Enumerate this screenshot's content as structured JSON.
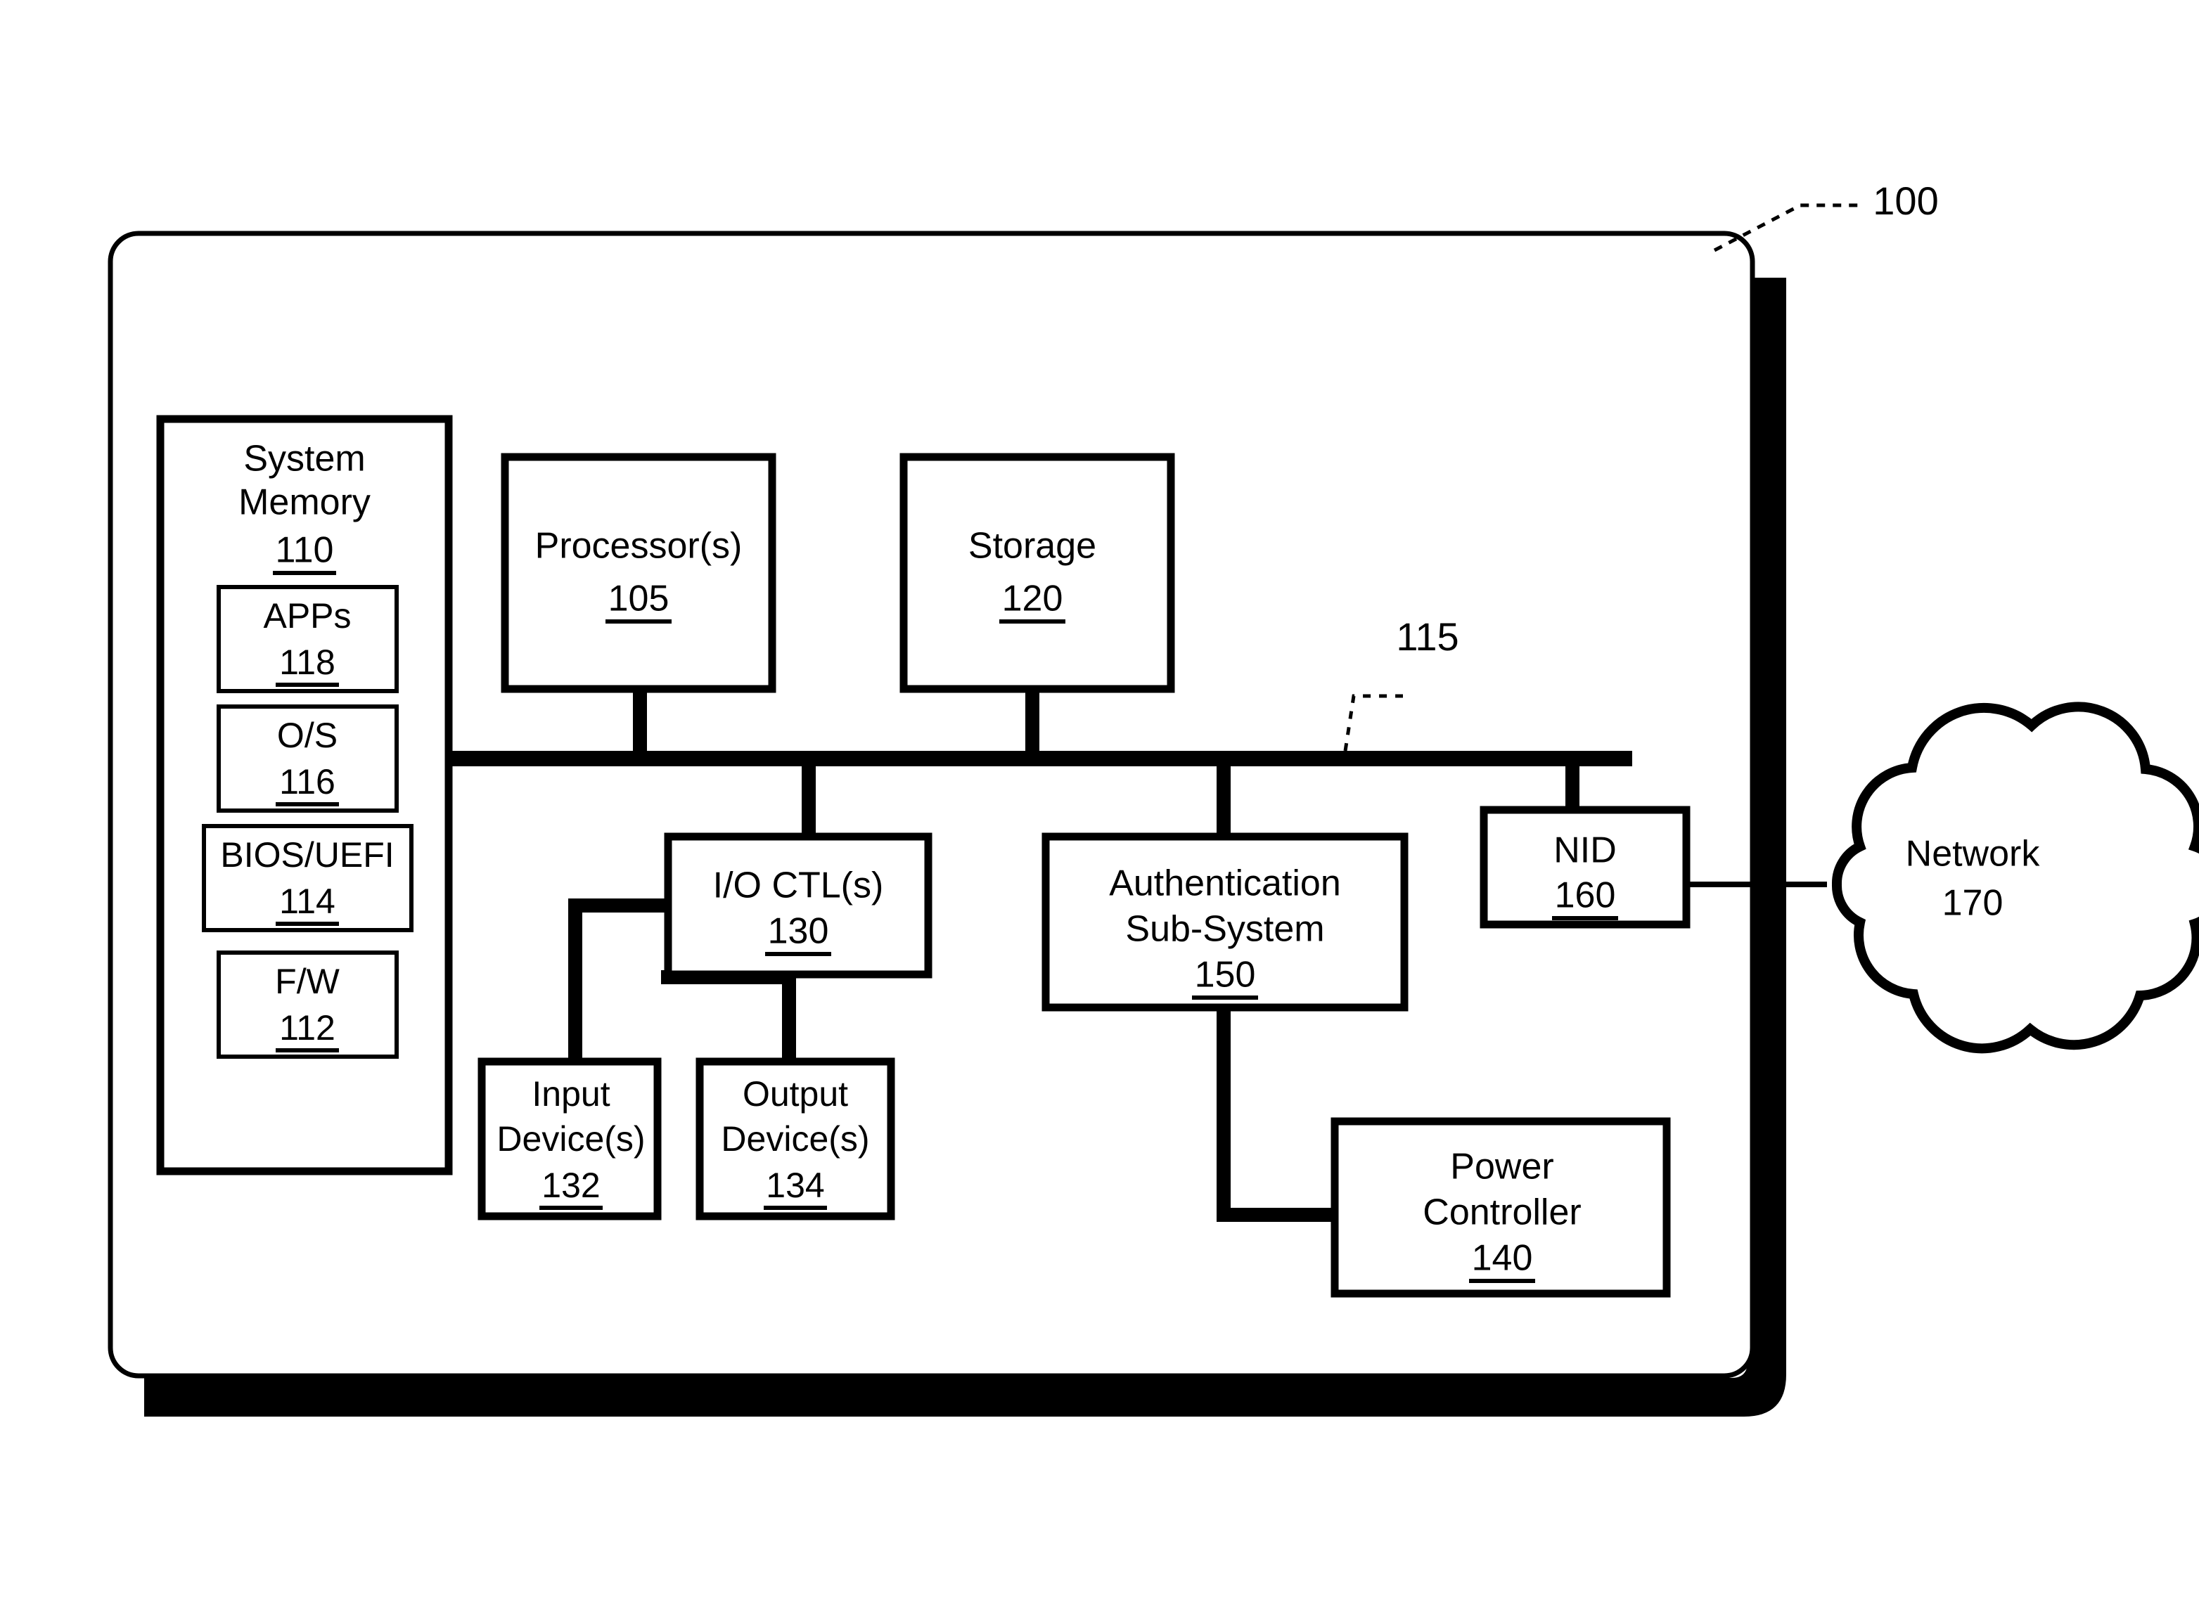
{
  "figure": {
    "type": "patent-block-diagram",
    "device_reference": "100",
    "bus_reference": "115"
  },
  "leaders": {
    "device": "100",
    "bus": "115"
  },
  "blocks": {
    "system_memory": {
      "title_line1": "System",
      "title_line2": "Memory",
      "ref": "110",
      "children": [
        {
          "label": "APPs",
          "ref": "118"
        },
        {
          "label": "O/S",
          "ref": "116"
        },
        {
          "label": "BIOS/UEFI",
          "ref": "114"
        },
        {
          "label": "F/W",
          "ref": "112"
        }
      ]
    },
    "processor": {
      "label": "Processor(s)",
      "ref": "105"
    },
    "storage": {
      "label": "Storage",
      "ref": "120"
    },
    "io_ctl": {
      "label": "I/O CTL(s)",
      "ref": "130"
    },
    "input_device": {
      "line1": "Input",
      "line2": "Device(s)",
      "ref": "132"
    },
    "output_device": {
      "line1": "Output",
      "line2": "Device(s)",
      "ref": "134"
    },
    "auth_subsystem": {
      "line1": "Authentication",
      "line2": "Sub-System",
      "ref": "150"
    },
    "power_controller": {
      "line1": "Power",
      "line2": "Controller",
      "ref": "140"
    },
    "nid": {
      "label": "NID",
      "ref": "160"
    },
    "network": {
      "label": "Network",
      "ref": "170"
    }
  },
  "colors": {
    "ink": "#000000",
    "paper": "#ffffff"
  }
}
